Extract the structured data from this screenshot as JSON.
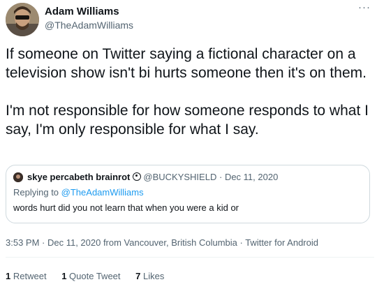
{
  "author": {
    "name": "Adam Williams",
    "handle": "@TheAdamWilliams"
  },
  "more_icon": "more-dots-icon",
  "tweet": {
    "paragraphs": [
      "If someone on Twitter saying a fictional character on a television show isn't bi hurts someone then it's on them.",
      "I'm not responsible for how someone responds to what I say, I'm only responsible for what I say."
    ]
  },
  "quote": {
    "name": "skye percabeth brainrot",
    "badge_icon": "circle-badge-icon",
    "handle": "@BUCKYSHIELD",
    "separator": "·",
    "date": "Dec 11, 2020",
    "replying_prefix": "Replying to",
    "replying_to": "@TheAdamWilliams",
    "text": "words hurt did you not learn that when you were a kid or"
  },
  "timestamp": "3:53 PM · Dec 11, 2020 from Vancouver, British Columbia · Twitter for Android",
  "stats": {
    "retweets": {
      "count": "1",
      "label": "Retweet"
    },
    "quote_tweets": {
      "count": "1",
      "label": "Quote Tweet"
    },
    "likes": {
      "count": "7",
      "label": "Likes"
    }
  },
  "colors": {
    "text": "#0f1419",
    "secondary": "#536471",
    "link": "#1d9bf0",
    "border": "#cfd9de"
  }
}
